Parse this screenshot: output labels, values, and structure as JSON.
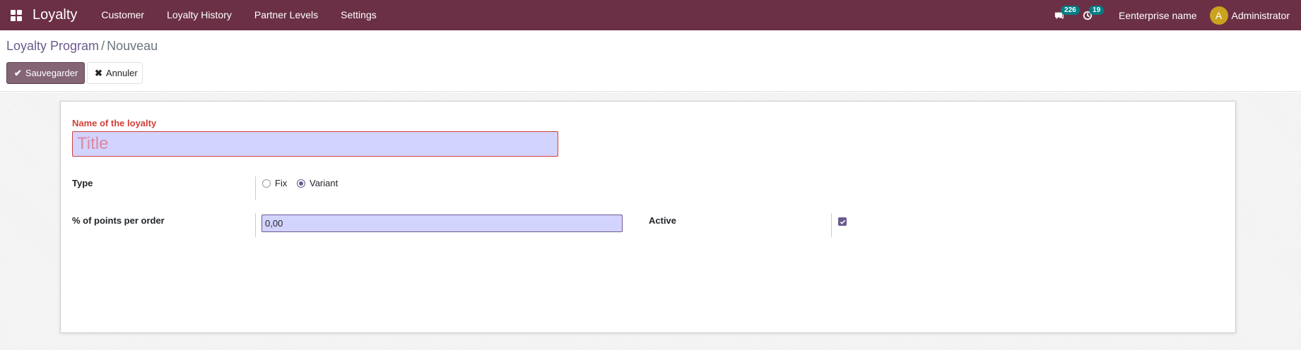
{
  "navbar": {
    "brand": "Loyalty",
    "menu": [
      {
        "label": "Customer"
      },
      {
        "label": "Loyalty History"
      },
      {
        "label": "Partner Levels"
      },
      {
        "label": "Settings"
      }
    ],
    "messages_badge": "226",
    "activities_badge": "19",
    "company": "Eenterprise name",
    "avatar_initial": "A",
    "user": "Administrator",
    "color": "#6b3045"
  },
  "breadcrumb": {
    "parent": "Loyalty Program",
    "separator": "/",
    "current": "Nouveau"
  },
  "buttons": {
    "save": "Sauvegarder",
    "cancel": "Annuler"
  },
  "form": {
    "name_label": "Name of the loyalty",
    "name_placeholder": "Title",
    "type_label": "Type",
    "type_options": [
      {
        "label": "Fix",
        "checked": false
      },
      {
        "label": "Variant",
        "checked": true
      }
    ],
    "points_label": "% of points per order",
    "points_value": "0,00",
    "active_label": "Active",
    "active_checked": true
  }
}
